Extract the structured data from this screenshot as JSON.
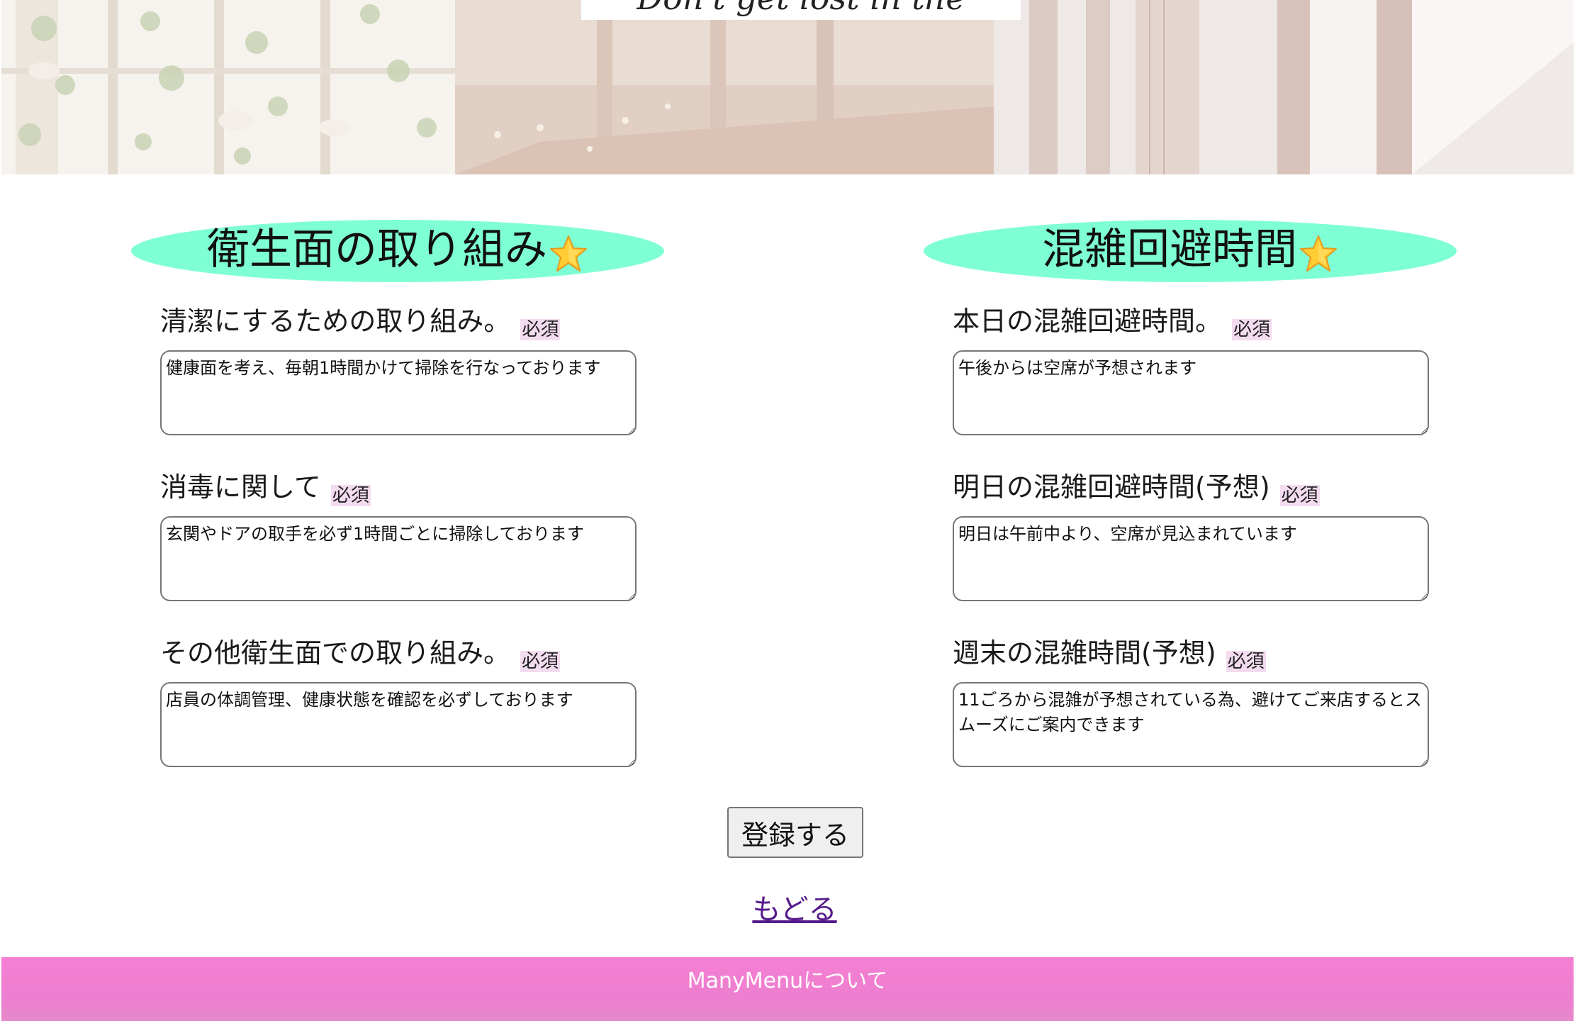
{
  "hero": {
    "tagline": "Don't get lost in the menu."
  },
  "sections": [
    {
      "heading": "衛生面の取り組み",
      "heading_icon": "star-icon",
      "fields": [
        {
          "label": "清潔にするための取り組み。",
          "required": "必須",
          "value": "健康面を考え、毎朝1時間かけて掃除を行なっております"
        },
        {
          "label": "消毒に関して",
          "required": "必須",
          "value": "玄関やドアの取手を必ず1時間ごとに掃除しております"
        },
        {
          "label": "その他衛生面での取り組み。",
          "required": "必須",
          "value": "店員の体調管理、健康状態を確認を必ずしております"
        }
      ]
    },
    {
      "heading": "混雑回避時間",
      "heading_icon": "star-icon",
      "fields": [
        {
          "label": "本日の混雑回避時間。",
          "required": "必須",
          "value": "午後からは空席が予想されます"
        },
        {
          "label": "明日の混雑回避時間(予想)",
          "required": "必須",
          "value": "明日は午前中より、空席が見込まれています"
        },
        {
          "label": "週末の混雑時間(予想)",
          "required": "必須",
          "value": "11ごろから混雑が予想されている為、避けてご来店するとスムーズにご案内できます"
        }
      ]
    }
  ],
  "actions": {
    "submit_label": "登録する",
    "back_label": "もどる"
  },
  "footer": {
    "about_label": "ManyMenuについて"
  },
  "colors": {
    "heading_bg": "#7fffd4",
    "required_badge_bg": "#f3dcef",
    "footer_bg": "#f47fd2",
    "link": "#551a8b"
  }
}
